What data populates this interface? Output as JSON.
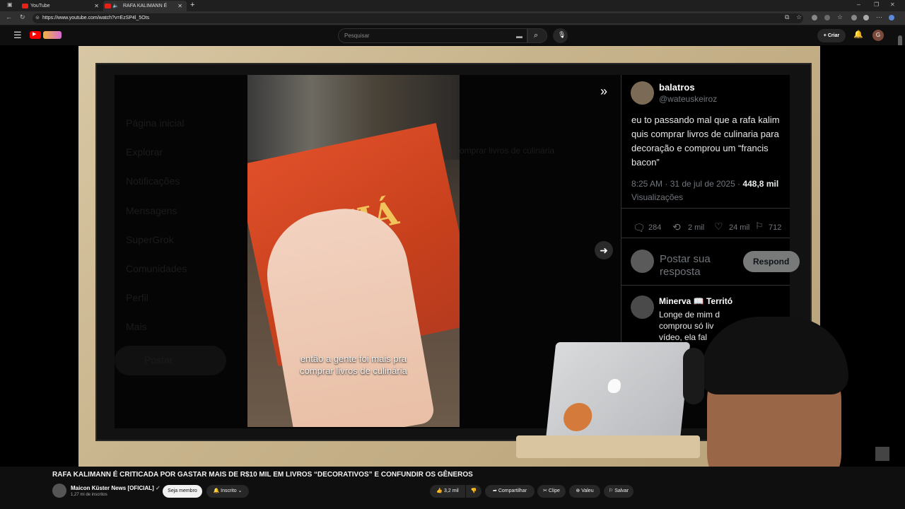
{
  "browser": {
    "tabs": [
      {
        "label": "YouTube"
      },
      {
        "label": "RAFA KALIMANN É CRITICA"
      }
    ],
    "url": "https://www.youtube.com/watch?v=EzSP4l_5Ots"
  },
  "youtube_header": {
    "search_placeholder": "Pesquisar",
    "create_label": "Criar",
    "avatar_initial": "G"
  },
  "video": {
    "caption_line1": "então a gente foi mais pra",
    "caption_line2": "comprar livros de culinária",
    "book_title": "CHÁ",
    "ghost_menu": [
      "Página inicial",
      "Explorar",
      "Notificações",
      "Mensagens",
      "SuperGrok",
      "Comunidades",
      "Perfil",
      "Mais",
      "Postar"
    ],
    "ghost_text": "omprar livros de culinária",
    "tweet": {
      "name": "balatros",
      "handle": "@wateuskeiroz",
      "text": "eu to passando mal que a rafa kalim quis comprar livros de culinaria para decoração e comprou um “francis bacon”",
      "time": "8:25 AM · 31 de jul de 2025 ·",
      "views_count": "448,8 mil",
      "views_label": "Visualizações",
      "replies": "284",
      "reposts": "2 mil",
      "likes": "24 mil",
      "bookmarks": "712",
      "reply_placeholder_1": "Postar sua",
      "reply_placeholder_2": "resposta",
      "reply_button": "Respond",
      "reply_author": "Minerva 📖 Territó",
      "reply_text": "Longe de mim d\ncomprou só liv\nvídeo, ela fal\nnária."
    }
  },
  "below_video": {
    "title": "RAFA KALIMANN É CRITICADA POR GASTAR MAIS DE R$10 MIL EM LIVROS “DECORATIVOS” E CONFUNDIR OS GÊNEROS",
    "channel_name": "Maicon Küster News [OFICIAL]",
    "subscribers": "1,27 mi de inscritos",
    "join_label": "Seja membro",
    "subscribed_label": "Inscrito",
    "likes": "3,2 mil",
    "share_label": "Compartilhar",
    "clip_label": "Clipe",
    "thanks_label": "Valeu",
    "save_label": "Salvar"
  }
}
